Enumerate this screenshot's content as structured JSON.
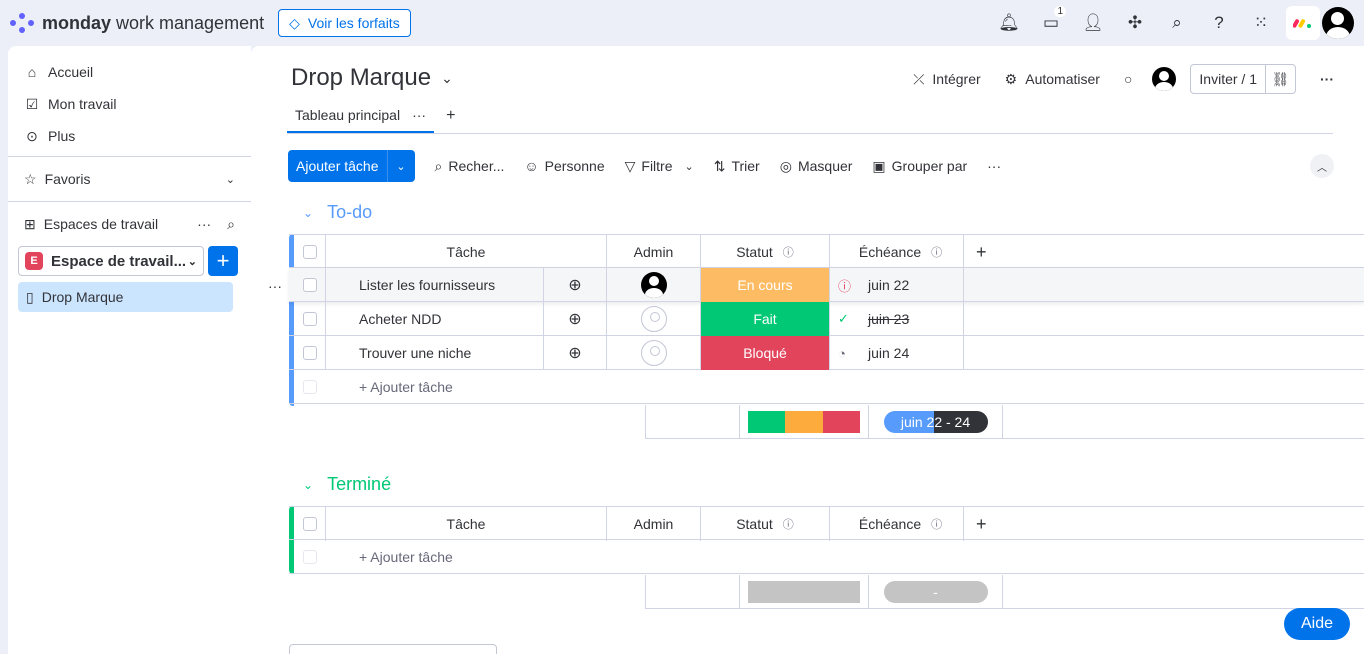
{
  "topbar": {
    "logo_bold": "monday",
    "logo_rest": " work management",
    "plans_label": "Voir les forfaits",
    "inbox_count": "1"
  },
  "sidebar": {
    "nav": [
      {
        "label": "Accueil",
        "icon": "home-icon"
      },
      {
        "label": "Mon travail",
        "icon": "calendar-check-icon"
      },
      {
        "label": "Plus",
        "icon": "more-circle-icon"
      }
    ],
    "favorites_label": "Favoris",
    "workspaces_label": "Espaces de travail",
    "workspace_letter": "E",
    "workspace_name": "Espace de travail...",
    "board_label": "Drop Marque"
  },
  "board": {
    "title": "Drop Marque",
    "actions": {
      "integrate": "Intégrer",
      "automate": "Automatiser",
      "invite": "Inviter / 1"
    },
    "tab_label": "Tableau principal",
    "toolbar": {
      "add_task": "Ajouter tâche",
      "search": "Recher...",
      "person": "Personne",
      "filter": "Filtre",
      "sort": "Trier",
      "hide": "Masquer",
      "group_by": "Grouper par"
    },
    "columns": {
      "task": "Tâche",
      "admin": "Admin",
      "status": "Statut",
      "due": "Échéance"
    },
    "groups": [
      {
        "title": "To-do",
        "color": "#579bfc",
        "rows": [
          {
            "task": "Lister les fournisseurs",
            "status": "En cours",
            "status_color": "#fdbc64",
            "due": "juin 22",
            "assigned": true
          },
          {
            "task": "Acheter NDD",
            "status": "Fait",
            "status_color": "#00c875",
            "due": "juin 23",
            "assigned": false
          },
          {
            "task": "Trouver une niche",
            "status": "Bloqué",
            "status_color": "#e2445c",
            "due": "juin 24",
            "assigned": false
          }
        ],
        "add_label": "+ Ajouter tâche",
        "summary_range": "juin 22 - 24"
      },
      {
        "title": "Terminé",
        "color": "#00c875",
        "rows": [],
        "add_label": "+ Ajouter tâche",
        "summary_range": "-"
      }
    ]
  },
  "help_label": "Aide"
}
